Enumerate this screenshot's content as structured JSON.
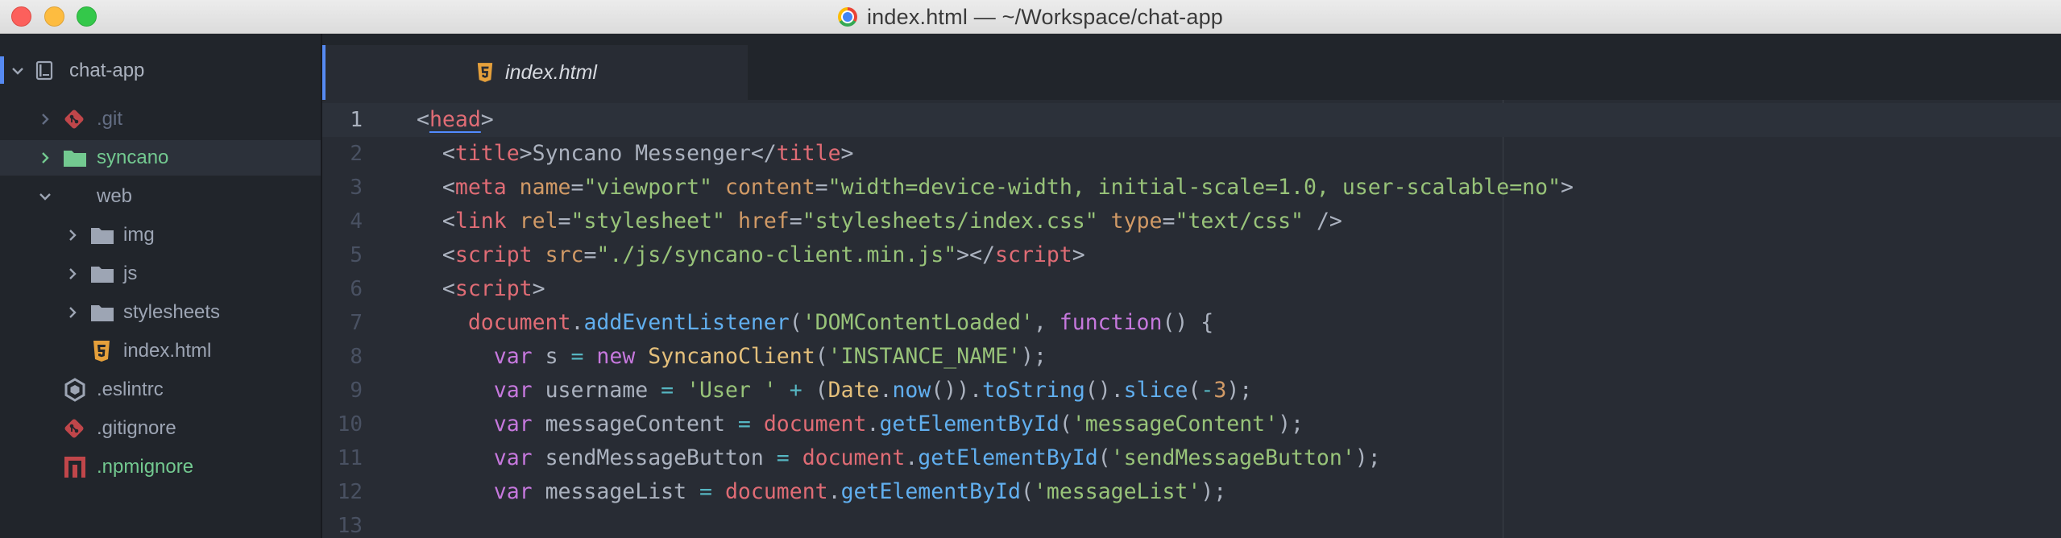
{
  "window": {
    "title": "index.html — ~/Workspace/chat-app"
  },
  "colors": {
    "accent": "#568af2",
    "sidebar_bg": "#21252b",
    "editor_bg": "#282c34",
    "vcs_added": "#73c990"
  },
  "sidebar": {
    "root": {
      "label": "chat-app",
      "icon": "repo-icon"
    },
    "items": [
      {
        "label": ".git",
        "icon": "git-icon",
        "status": "ignored"
      },
      {
        "label": "syncano",
        "icon": "folder-icon",
        "status": "added",
        "selected": true
      },
      {
        "label": "web",
        "icon": "folder-icon",
        "expanded": true
      },
      {
        "label": "img",
        "icon": "folder-icon"
      },
      {
        "label": "js",
        "icon": "folder-icon"
      },
      {
        "label": "stylesheets",
        "icon": "folder-icon"
      },
      {
        "label": "index.html",
        "icon": "html5-icon"
      },
      {
        "label": ".eslintrc",
        "icon": "eslint-icon"
      },
      {
        "label": ".gitignore",
        "icon": "git-icon"
      },
      {
        "label": ".npmignore",
        "icon": "npm-icon",
        "status": "added"
      }
    ]
  },
  "tabs": [
    {
      "label": "index.html",
      "icon": "html5-icon",
      "active": true
    }
  ],
  "editor": {
    "cursor_line": 1,
    "lines": [
      {
        "num": "1",
        "tokens": [
          [
            "plain",
            "<"
          ],
          [
            "tag",
            "head"
          ],
          [
            "plain",
            ">"
          ]
        ]
      },
      {
        "num": "2",
        "tokens": [
          [
            "plain",
            "  <"
          ],
          [
            "tag",
            "title"
          ],
          [
            "plain",
            ">Syncano Messenger</"
          ],
          [
            "tag",
            "title"
          ],
          [
            "plain",
            ">"
          ]
        ]
      },
      {
        "num": "3",
        "tokens": [
          [
            "plain",
            "  <"
          ],
          [
            "tag",
            "meta"
          ],
          [
            "plain",
            " "
          ],
          [
            "attr",
            "name"
          ],
          [
            "plain",
            "="
          ],
          [
            "str",
            "\"viewport\""
          ],
          [
            "plain",
            " "
          ],
          [
            "attr",
            "content"
          ],
          [
            "plain",
            "="
          ],
          [
            "str",
            "\"width=device-width, initial-scale=1.0, user-scalable=no\""
          ],
          [
            "plain",
            ">"
          ]
        ]
      },
      {
        "num": "4",
        "tokens": [
          [
            "plain",
            "  <"
          ],
          [
            "tag",
            "link"
          ],
          [
            "plain",
            " "
          ],
          [
            "attr",
            "rel"
          ],
          [
            "plain",
            "="
          ],
          [
            "str",
            "\"stylesheet\""
          ],
          [
            "plain",
            " "
          ],
          [
            "attr",
            "href"
          ],
          [
            "plain",
            "="
          ],
          [
            "str",
            "\"stylesheets/index.css\""
          ],
          [
            "plain",
            " "
          ],
          [
            "attr",
            "type"
          ],
          [
            "plain",
            "="
          ],
          [
            "str",
            "\"text/css\""
          ],
          [
            "plain",
            " />"
          ]
        ]
      },
      {
        "num": "5",
        "tokens": [
          [
            "plain",
            "  <"
          ],
          [
            "tag",
            "script"
          ],
          [
            "plain",
            " "
          ],
          [
            "attr",
            "src"
          ],
          [
            "plain",
            "="
          ],
          [
            "str",
            "\"./js/syncano-client.min.js\""
          ],
          [
            "plain",
            "></"
          ],
          [
            "tag",
            "script"
          ],
          [
            "plain",
            ">"
          ]
        ]
      },
      {
        "num": "6",
        "tokens": [
          [
            "plain",
            "  <"
          ],
          [
            "tag",
            "script"
          ],
          [
            "plain",
            ">"
          ]
        ]
      },
      {
        "num": "7",
        "tokens": [
          [
            "plain",
            "    "
          ],
          [
            "obj",
            "document"
          ],
          [
            "plain",
            "."
          ],
          [
            "fn",
            "addEventListener"
          ],
          [
            "plain",
            "("
          ],
          [
            "str",
            "'DOMContentLoaded'"
          ],
          [
            "plain",
            ", "
          ],
          [
            "kw",
            "function"
          ],
          [
            "plain",
            "() {"
          ]
        ]
      },
      {
        "num": "8",
        "tokens": [
          [
            "plain",
            "      "
          ],
          [
            "kw",
            "var"
          ],
          [
            "plain",
            " s "
          ],
          [
            "op",
            "="
          ],
          [
            "plain",
            " "
          ],
          [
            "kw",
            "new"
          ],
          [
            "plain",
            " "
          ],
          [
            "cls",
            "SyncanoClient"
          ],
          [
            "plain",
            "("
          ],
          [
            "str",
            "'INSTANCE_NAME'"
          ],
          [
            "plain",
            ");"
          ]
        ]
      },
      {
        "num": "9",
        "tokens": [
          [
            "plain",
            "      "
          ],
          [
            "kw",
            "var"
          ],
          [
            "plain",
            " username "
          ],
          [
            "op",
            "="
          ],
          [
            "plain",
            " "
          ],
          [
            "str",
            "'User '"
          ],
          [
            "plain",
            " "
          ],
          [
            "op",
            "+"
          ],
          [
            "plain",
            " ("
          ],
          [
            "cls",
            "Date"
          ],
          [
            "plain",
            "."
          ],
          [
            "fn",
            "now"
          ],
          [
            "plain",
            "())."
          ],
          [
            "fn",
            "toString"
          ],
          [
            "plain",
            "()."
          ],
          [
            "fn",
            "slice"
          ],
          [
            "plain",
            "("
          ],
          [
            "op",
            "-"
          ],
          [
            "num",
            "3"
          ],
          [
            "plain",
            ");"
          ]
        ]
      },
      {
        "num": "10",
        "tokens": [
          [
            "plain",
            "      "
          ],
          [
            "kw",
            "var"
          ],
          [
            "plain",
            " messageContent "
          ],
          [
            "op",
            "="
          ],
          [
            "plain",
            " "
          ],
          [
            "obj",
            "document"
          ],
          [
            "plain",
            "."
          ],
          [
            "fn",
            "getElementById"
          ],
          [
            "plain",
            "("
          ],
          [
            "str",
            "'messageContent'"
          ],
          [
            "plain",
            ");"
          ]
        ]
      },
      {
        "num": "11",
        "tokens": [
          [
            "plain",
            "      "
          ],
          [
            "kw",
            "var"
          ],
          [
            "plain",
            " sendMessageButton "
          ],
          [
            "op",
            "="
          ],
          [
            "plain",
            " "
          ],
          [
            "obj",
            "document"
          ],
          [
            "plain",
            "."
          ],
          [
            "fn",
            "getElementById"
          ],
          [
            "plain",
            "("
          ],
          [
            "str",
            "'sendMessageButton'"
          ],
          [
            "plain",
            ");"
          ]
        ]
      },
      {
        "num": "12",
        "tokens": [
          [
            "plain",
            "      "
          ],
          [
            "kw",
            "var"
          ],
          [
            "plain",
            " messageList "
          ],
          [
            "op",
            "="
          ],
          [
            "plain",
            " "
          ],
          [
            "obj",
            "document"
          ],
          [
            "plain",
            "."
          ],
          [
            "fn",
            "getElementById"
          ],
          [
            "plain",
            "("
          ],
          [
            "str",
            "'messageList'"
          ],
          [
            "plain",
            ");"
          ]
        ]
      },
      {
        "num": "13",
        "tokens": []
      }
    ]
  }
}
